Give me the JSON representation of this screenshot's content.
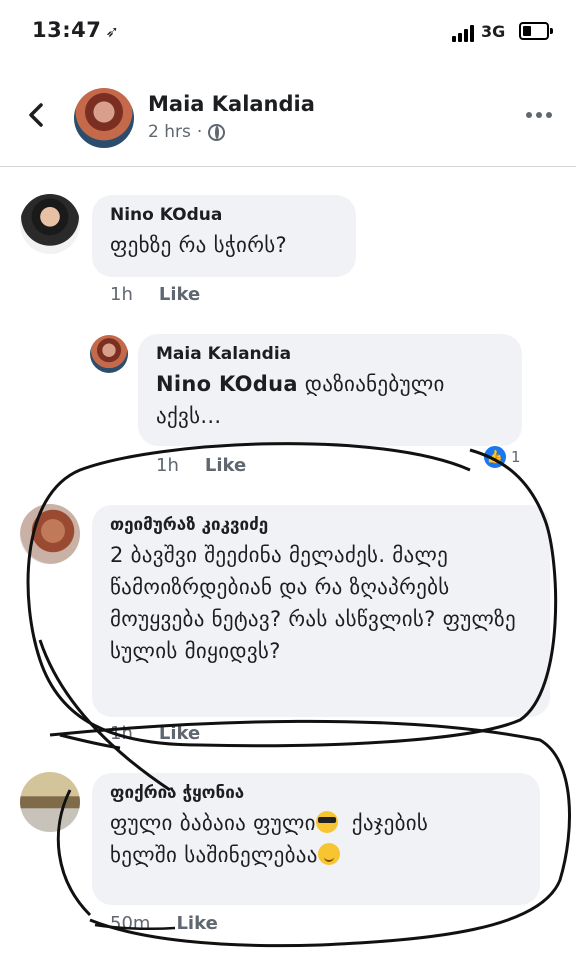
{
  "status_bar": {
    "time": "13:47",
    "network": "3G"
  },
  "post_header": {
    "author": "Maia Kalandia",
    "time": "2 hrs",
    "separator": "·"
  },
  "comments": [
    {
      "author": "Nino KOdua",
      "text": "ფეხზე რა სჭირს?",
      "time": "1h",
      "like": "Like"
    },
    {
      "author": "Maia Kalandia",
      "mention": "Nino KOdua",
      "text": "დაზიანებული აქვს...",
      "time": "1h",
      "like": "Like",
      "reaction_count": "1"
    },
    {
      "author": "თეიმურაზ კიკვიძე",
      "text": "2 ბავშვი შეეძინა მელაძეს. მალე წამოიზრდებიან და რა ზღაპრებს მოუყვება ნეტავ? რას ასწვლის? ფულზე სულის მიყიდვს?",
      "time": "1h",
      "like": "Like"
    },
    {
      "author": "ფიქრია ჭყონია",
      "text_line1": "ფული ბაბაია ფული",
      "text_line1b": "ქაჯების",
      "text_line2": "ხელში საშინელებაა",
      "time": "50m",
      "like": "Like"
    }
  ],
  "icons": {
    "back": "chevron-left-icon",
    "more": "more-dots-icon",
    "privacy": "globe-icon",
    "reaction": "thumbs-up-icon"
  },
  "colors": {
    "bubble": "#f0f2f5",
    "meta": "#606770",
    "reaction": "#1877f2"
  }
}
